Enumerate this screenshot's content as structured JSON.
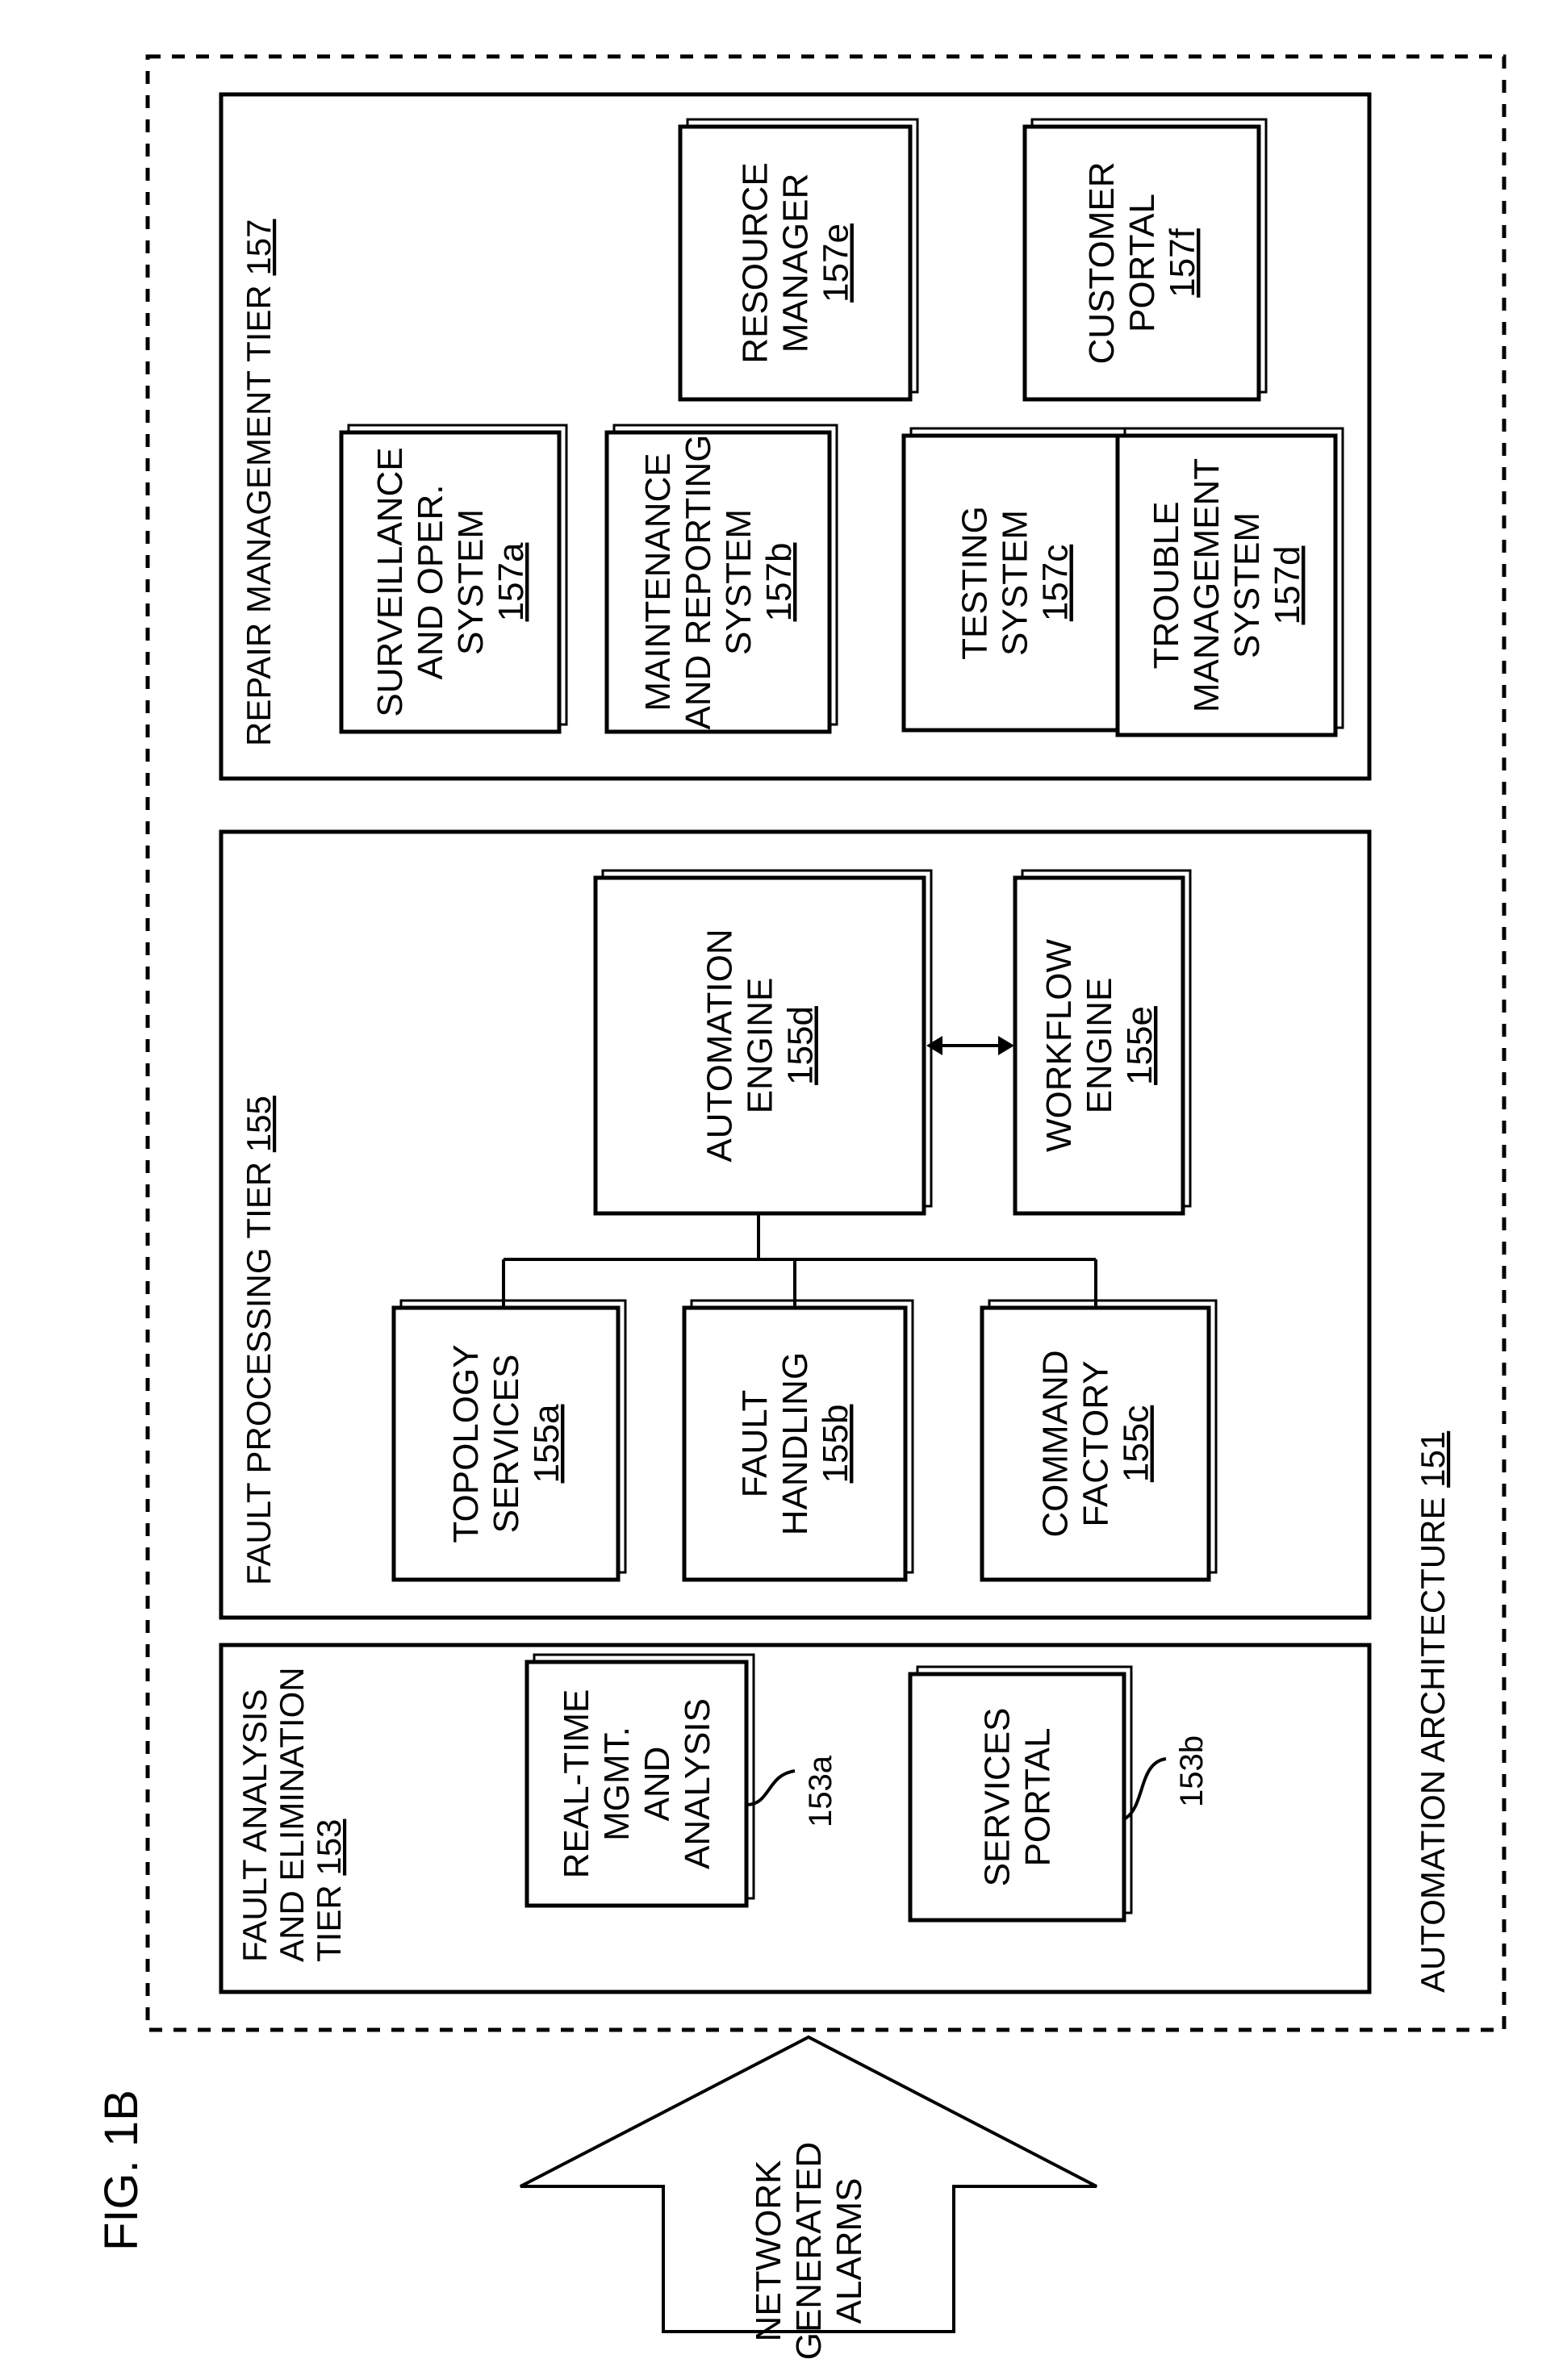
{
  "figure_label": "FIG. 1B",
  "input_arrow": {
    "lines": [
      "NETWORK",
      "GENERATED",
      "ALARMS"
    ]
  },
  "architecture": {
    "label": "AUTOMATION ARCHITECTURE",
    "ref": "151"
  },
  "tiers": {
    "repair": {
      "label": "REPAIR MANAGEMENT TIER",
      "ref": "157",
      "components": {
        "a": {
          "lines": [
            "SURVEILLANCE",
            "AND OPER.",
            "SYSTEM"
          ],
          "ref": "157a"
        },
        "b": {
          "lines": [
            "MAINTENANCE",
            "AND REPORTING",
            "SYSTEM"
          ],
          "ref": "157b"
        },
        "c": {
          "lines": [
            "TESTING",
            "SYSTEM"
          ],
          "ref": "157c"
        },
        "d": {
          "lines": [
            "TROUBLE",
            "MANAGEMENT",
            "SYSTEM"
          ],
          "ref": "157d"
        },
        "e": {
          "lines": [
            "RESOURCE",
            "MANAGER"
          ],
          "ref": "157e"
        },
        "f": {
          "lines": [
            "CUSTOMER",
            "PORTAL"
          ],
          "ref": "157f"
        }
      }
    },
    "processing": {
      "label": "FAULT PROCESSING TIER",
      "ref": "155",
      "components": {
        "a": {
          "lines": [
            "TOPOLOGY",
            "SERVICES"
          ],
          "ref": "155a"
        },
        "b": {
          "lines": [
            "FAULT",
            "HANDLING"
          ],
          "ref": "155b"
        },
        "c": {
          "lines": [
            "COMMAND",
            "FACTORY"
          ],
          "ref": "155c"
        },
        "d": {
          "lines": [
            "AUTOMATION",
            "ENGINE"
          ],
          "ref": "155d"
        },
        "e": {
          "lines": [
            "WORKFLOW",
            "ENGINE"
          ],
          "ref": "155e"
        }
      }
    },
    "analysis": {
      "label_lines": [
        "FAULT ANALYSIS",
        "AND ELIMINATION",
        "TIER"
      ],
      "ref": "153",
      "components": {
        "a": {
          "lines": [
            "REAL-TIME",
            "MGMT.",
            "AND",
            "ANALYSIS"
          ],
          "ref": "153a"
        },
        "b": {
          "lines": [
            "SERVICES",
            "PORTAL"
          ],
          "ref": "153b"
        }
      }
    }
  }
}
